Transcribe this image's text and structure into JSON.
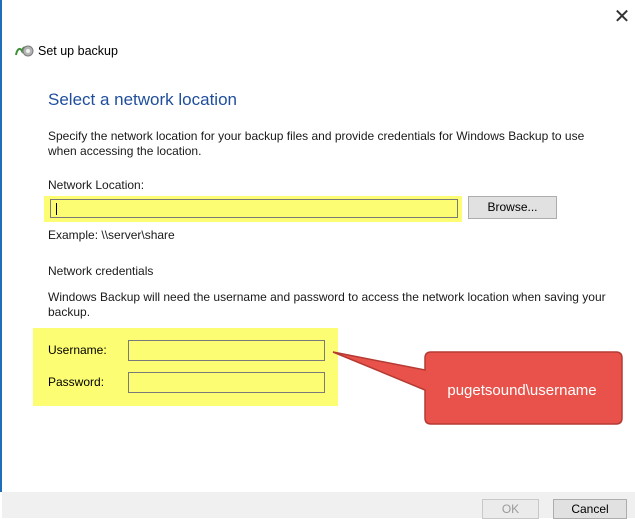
{
  "window": {
    "title": "Set up backup",
    "close_glyph": "✕"
  },
  "page": {
    "heading": "Select a network location",
    "description": "Specify the network location for your backup files and provide credentials for Windows Backup to use when accessing the location."
  },
  "network_location": {
    "label": "Network Location:",
    "value": "",
    "browse_label": "Browse...",
    "example": "Example: \\\\server\\share"
  },
  "credentials": {
    "section_label": "Network credentials",
    "description": "Windows Backup will need the username and password to access the network location when saving your backup.",
    "username_label": "Username:",
    "username_value": "",
    "password_label": "Password:",
    "password_value": ""
  },
  "callout": {
    "text": "pugetsound\\username"
  },
  "footer": {
    "ok_label": "OK",
    "cancel_label": "Cancel"
  },
  "colors": {
    "highlight": "#fdfd73",
    "callout_fill": "#e8524a",
    "heading": "#1f4e9c"
  }
}
